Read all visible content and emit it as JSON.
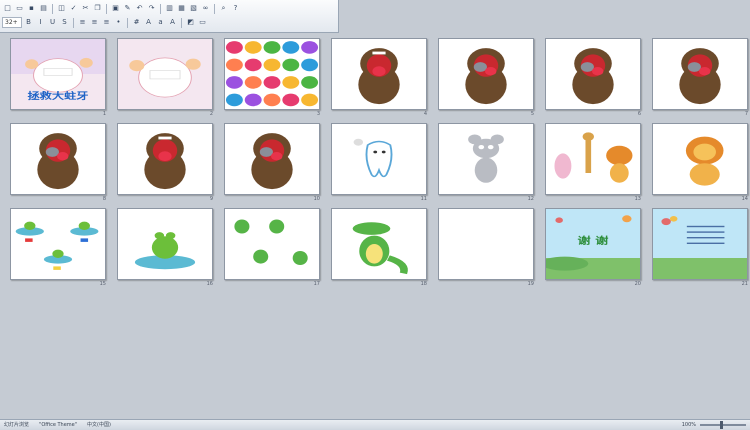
{
  "toolbar": {
    "font_size": "32+",
    "row1_icons": [
      "new-icon",
      "open-icon",
      "save-icon",
      "print-icon",
      "preview-icon",
      "spell-icon",
      "cut-icon",
      "copy-icon",
      "paste-icon",
      "format-painter-icon",
      "undo-icon",
      "redo-icon",
      "insert-chart-icon",
      "insert-table-icon",
      "insert-picture-icon",
      "hyperlink-icon",
      "zoom-icon",
      "help-icon"
    ],
    "row2_icons": [
      "bold-icon",
      "italic-icon",
      "underline-icon",
      "shadow-icon",
      "align-left-icon",
      "align-center-icon",
      "align-right-icon",
      "bullets-icon",
      "numbering-icon",
      "increase-font-icon",
      "decrease-font-icon",
      "font-color-icon",
      "design-icon",
      "new-slide-icon"
    ]
  },
  "slides": [
    {
      "n": "1",
      "title": "拯救大蛀牙",
      "theme": "cover"
    },
    {
      "n": "2",
      "theme": "cover-plain"
    },
    {
      "n": "3",
      "theme": "candy"
    },
    {
      "n": "4",
      "theme": "monster"
    },
    {
      "n": "5",
      "theme": "monster-bug"
    },
    {
      "n": "6",
      "theme": "monster-bug"
    },
    {
      "n": "7",
      "theme": "monster-bug"
    },
    {
      "n": "8",
      "theme": "monster-bug"
    },
    {
      "n": "9",
      "theme": "monster"
    },
    {
      "n": "10",
      "theme": "monster-bug"
    },
    {
      "n": "11",
      "theme": "tooth"
    },
    {
      "n": "12",
      "theme": "mouse"
    },
    {
      "n": "13",
      "theme": "animals"
    },
    {
      "n": "14",
      "theme": "lion"
    },
    {
      "n": "15",
      "theme": "frogs"
    },
    {
      "n": "16",
      "theme": "frog"
    },
    {
      "n": "17",
      "theme": "crocs"
    },
    {
      "n": "18",
      "theme": "croc"
    },
    {
      "n": "19",
      "theme": "blank"
    },
    {
      "n": "20",
      "title": "谢 谢",
      "theme": "thanks"
    },
    {
      "n": "21",
      "theme": "thanks-text"
    }
  ],
  "status": {
    "view": "幻灯片浏览",
    "theme": "\"Office Theme\"",
    "lang": "中文(中国)",
    "zoom": "100%"
  },
  "colors": {
    "workspace": "#c5cbd3",
    "selection": "#f3b13a"
  }
}
